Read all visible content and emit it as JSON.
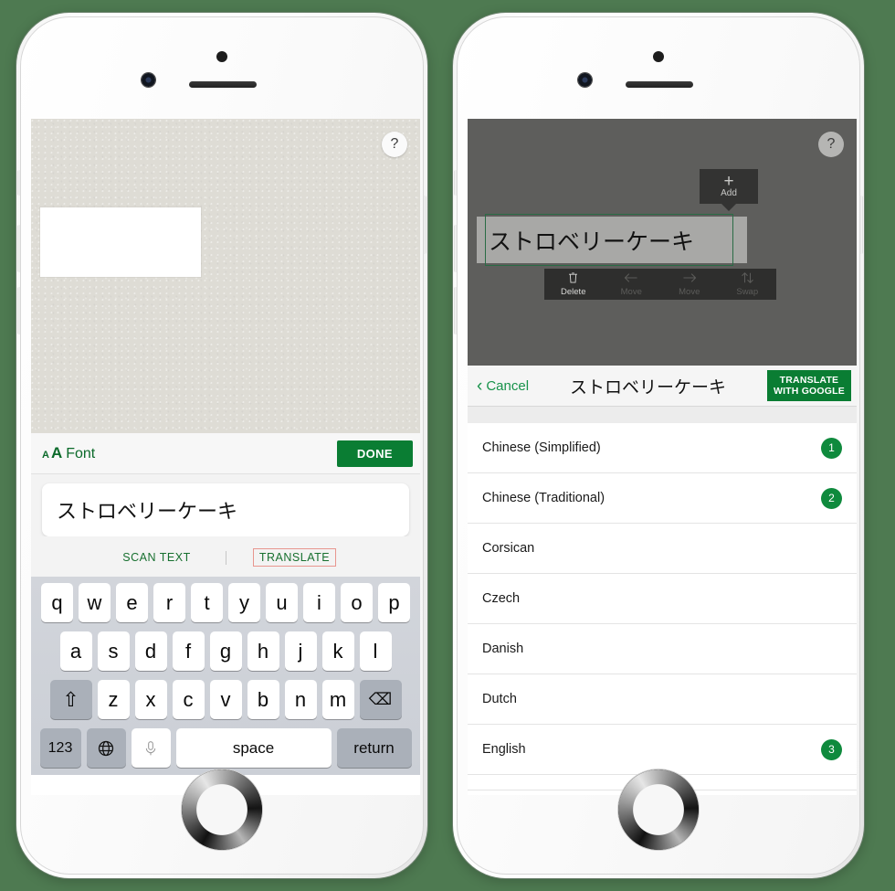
{
  "background_color": "#4e7a51",
  "accent_green": "#0a7d33",
  "left_phone": {
    "photo": {
      "help_icon": "question-mark-icon",
      "help_label": "?"
    },
    "font_bar": {
      "aa_small": "A",
      "aa_big": "A",
      "font_label": "Font",
      "done_label": "DONE"
    },
    "text_field": {
      "value": "ストロベリーケーキ",
      "placeholder": "ストロベリーケーキ"
    },
    "actions": {
      "scan_text": "SCAN TEXT",
      "translate": "TRANSLATE"
    },
    "keyboard": {
      "row1": [
        "q",
        "w",
        "e",
        "r",
        "t",
        "y",
        "u",
        "i",
        "o",
        "p"
      ],
      "row2": [
        "a",
        "s",
        "d",
        "f",
        "g",
        "h",
        "j",
        "k",
        "l"
      ],
      "row3": [
        "z",
        "x",
        "c",
        "v",
        "b",
        "n",
        "m"
      ],
      "shift_label": "⇧",
      "backspace_label": "⌫",
      "numbers_label": "123",
      "globe_label": "⊕",
      "mic_label": "·",
      "space_label": "space",
      "return_label": "return"
    }
  },
  "right_phone": {
    "editor": {
      "help_label": "?",
      "add_tooltip": {
        "plus": "+",
        "label": "Add"
      },
      "text_block": "ストロベリーケーキ",
      "tools": [
        {
          "icon": "trash-icon",
          "glyph": "⌧",
          "label": "Delete",
          "enabled": true
        },
        {
          "icon": "arrow-left-icon",
          "glyph": "←",
          "label": "Move",
          "enabled": false
        },
        {
          "icon": "arrow-right-icon",
          "glyph": "→",
          "label": "Move",
          "enabled": false
        },
        {
          "icon": "swap-icon",
          "glyph": "⇅",
          "label": "Swap",
          "enabled": false
        }
      ]
    },
    "navbar": {
      "cancel_label": "Cancel",
      "chevron": "‹",
      "title": "ストロベリーケーキ",
      "translate_line1": "TRANSLATE",
      "translate_line2": "WITH GOOGLE"
    },
    "languages": [
      {
        "name": "Chinese (Simplified)",
        "badge": "1"
      },
      {
        "name": "Chinese (Traditional)",
        "badge": "2"
      },
      {
        "name": "Corsican",
        "badge": ""
      },
      {
        "name": "Czech",
        "badge": ""
      },
      {
        "name": "Danish",
        "badge": ""
      },
      {
        "name": "Dutch",
        "badge": ""
      },
      {
        "name": "English",
        "badge": "3"
      }
    ]
  }
}
